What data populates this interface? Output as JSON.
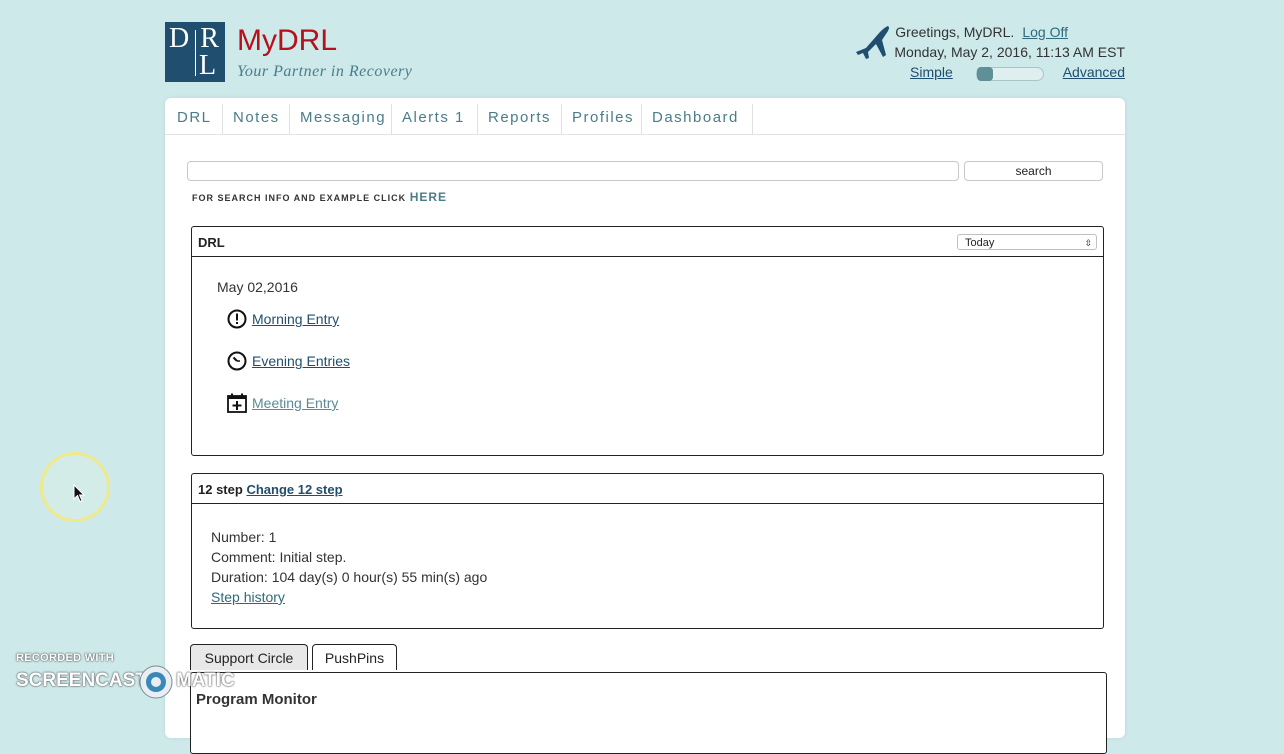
{
  "header": {
    "logo_letters": "DRL",
    "brand": "MyDRL",
    "tagline": "Your Partner in Recovery",
    "greeting": "Greetings, MyDRL.",
    "logoff_label": "Log Off",
    "datetime": "Monday, May 2, 2016, 11:13 AM EST",
    "mode_simple": "Simple",
    "mode_advanced": "Advanced",
    "mode_level": 0
  },
  "nav": {
    "items": [
      {
        "label": "DRL"
      },
      {
        "label": "Notes"
      },
      {
        "label": "Messaging"
      },
      {
        "label": "Alerts 1"
      },
      {
        "label": "Reports"
      },
      {
        "label": "Profiles"
      },
      {
        "label": "Dashboard"
      }
    ]
  },
  "search": {
    "value": "",
    "button_label": "search",
    "info_text": "FOR SEARCH INFO AND EXAMPLE CLICK",
    "info_link": "HERE"
  },
  "drl_box": {
    "title": "DRL",
    "period_selected": "Today",
    "date": "May 02,2016",
    "entries": [
      {
        "label": "Morning Entry",
        "icon": "alert-circle-icon"
      },
      {
        "label": "Evening Entries",
        "icon": "clock-icon"
      },
      {
        "label": "Meeting Entry",
        "icon": "calendar-add-icon"
      }
    ]
  },
  "step_box": {
    "title": "12 step",
    "change_link": "Change 12 step",
    "number": "Number: 1",
    "comment": "Comment: Initial step.",
    "duration": "Duration: 104 day(s) 0 hour(s) 55 min(s) ago",
    "history_link": "Step history"
  },
  "tabs": [
    {
      "label": "Support Circle",
      "active": true
    },
    {
      "label": "PushPins",
      "active": false
    }
  ],
  "program_monitor": {
    "title": "Program Monitor"
  },
  "watermark": {
    "line1": "RECORDED WITH",
    "line2a": "SCREENCAST",
    "line2b": "MATIC"
  },
  "colors": {
    "background": "#cde9ea",
    "brand_red": "#b5111a",
    "accent_teal": "#4a7d88",
    "logo_navy": "#1f4e6e"
  }
}
